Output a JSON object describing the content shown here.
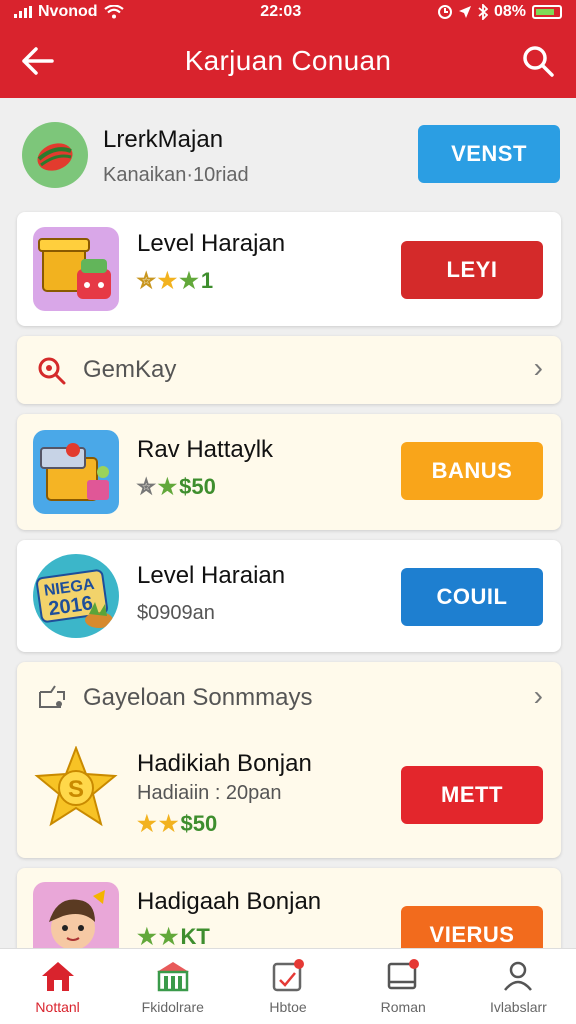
{
  "status_bar": {
    "carrier": "Nvonod",
    "time": "22:03",
    "battery": "08%"
  },
  "header": {
    "title": "Karjuan Conuan"
  },
  "profile": {
    "name": "LrerkMajan",
    "subtitle": "Kanaikan·10riad",
    "button": "VENST"
  },
  "cards": [
    {
      "name": "Level Harajan",
      "sub": "",
      "rating_text": "1",
      "button": "LEYI",
      "button_color": "#d42a2a"
    },
    {
      "name": "Rav Hattaylk",
      "sub": "",
      "rating_text": "$50",
      "button": "BANUS",
      "button_color": "#f9a51a"
    },
    {
      "name": "Level Haraian",
      "sub": "$0909an",
      "rating_text": "",
      "button": "COUIL",
      "button_color": "#1e7fd0",
      "thumb_text_1": "NIEGA",
      "thumb_text_2": "2016"
    },
    {
      "name": "Hadikiah Bonjan",
      "sub": "Hadiaiin : 20pan",
      "rating_text": "$50",
      "button": "METT",
      "button_color": "#e3262c",
      "thumb_text": "S"
    },
    {
      "name": "Hadigaah Bonjan",
      "sub": "",
      "rating_text": "KT",
      "button": "VIERUS",
      "button_color": "#f26b1d"
    }
  ],
  "sections": [
    {
      "label": "GemKay"
    },
    {
      "label": "Gayeloan Sonmmays"
    }
  ],
  "bottom_nav": [
    {
      "label": "Nottanl",
      "icon": "home-icon"
    },
    {
      "label": "Fkidolrare",
      "icon": "store-icon"
    },
    {
      "label": "Hbtoe",
      "icon": "task-icon"
    },
    {
      "label": "Roman",
      "icon": "inbox-icon"
    },
    {
      "label": "Ivlabslarr",
      "icon": "profile-icon"
    }
  ],
  "colors": {
    "header": "#d9232d",
    "accent_blue": "#2b9ee3"
  }
}
